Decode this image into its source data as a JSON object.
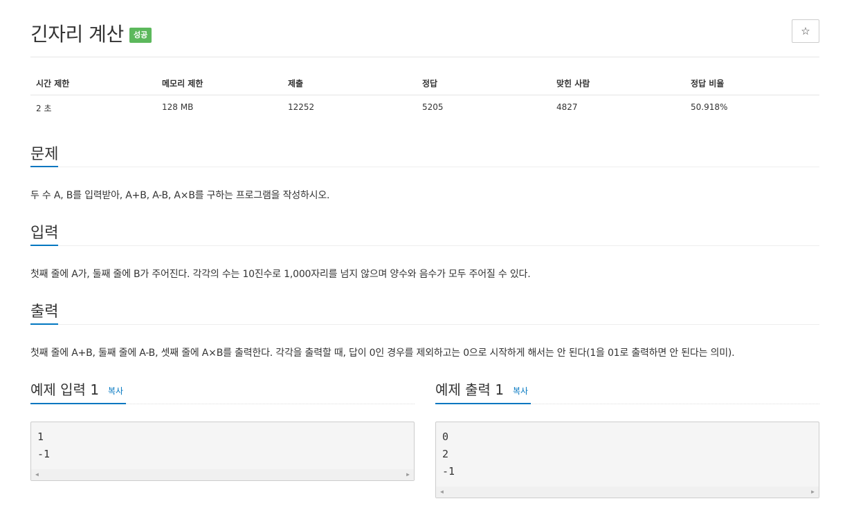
{
  "header": {
    "title": "긴자리 계산",
    "badge": "성공",
    "star_icon": "☆"
  },
  "info_table": {
    "headers": [
      "시간 제한",
      "메모리 제한",
      "제출",
      "정답",
      "맞힌 사람",
      "정답 비율"
    ],
    "values": [
      "2 초",
      "128 MB",
      "12252",
      "5205",
      "4827",
      "50.918%"
    ]
  },
  "sections": {
    "problem": {
      "title": "문제",
      "text": "두 수 A, B를 입력받아, A+B, A-B, A×B를 구하는 프로그램을 작성하시오."
    },
    "input": {
      "title": "입력",
      "text": "첫째 줄에 A가, 둘째 줄에 B가 주어진다. 각각의 수는 10진수로 1,000자리를 넘지 않으며 양수와 음수가 모두 주어질 수 있다."
    },
    "output": {
      "title": "출력",
      "text": "첫째 줄에 A+B, 둘째 줄에 A-B, 셋째 줄에 A×B를 출력한다. 각각을 출력할 때, 답이 0인 경우를 제외하고는 0으로 시작하게 해서는 안 된다(1을 01로 출력하면 안 된다는 의미)."
    }
  },
  "examples": {
    "input": {
      "title": "예제 입력 1",
      "copy_label": "복사",
      "lines": [
        "1",
        "-1"
      ]
    },
    "output": {
      "title": "예제 출력 1",
      "copy_label": "복사",
      "lines": [
        "0",
        "2",
        "-1"
      ]
    }
  },
  "colors": {
    "accent": "#0076c0",
    "success_badge": "#5cb85c"
  }
}
